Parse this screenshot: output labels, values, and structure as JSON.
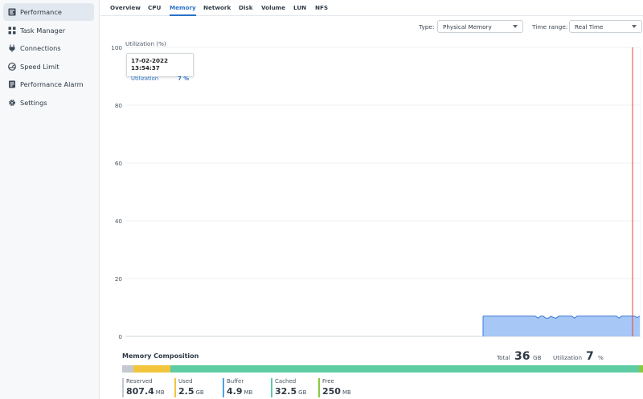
{
  "sidebar": {
    "items": [
      {
        "label": "Performance",
        "icon": "performance-icon",
        "active": true
      },
      {
        "label": "Task Manager",
        "icon": "task-manager-icon",
        "active": false
      },
      {
        "label": "Connections",
        "icon": "connections-icon",
        "active": false
      },
      {
        "label": "Speed Limit",
        "icon": "speed-limit-icon",
        "active": false
      },
      {
        "label": "Performance Alarm",
        "icon": "alarm-icon",
        "active": false
      },
      {
        "label": "Settings",
        "icon": "gear-icon",
        "active": false
      }
    ]
  },
  "tabs": [
    "Overview",
    "CPU",
    "Memory",
    "Network",
    "Disk",
    "Volume",
    "LUN",
    "NFS"
  ],
  "active_tab": "Memory",
  "controls": {
    "type_label": "Type:",
    "type_value": "Physical Memory",
    "time_label": "Time range:",
    "time_value": "Real Time"
  },
  "tooltip": {
    "date": "17-02-2022 13:54:37",
    "label": "Utilization",
    "value": "7 %"
  },
  "chart_data": {
    "type": "area",
    "ylabel": "Utilization (%)",
    "ylim": [
      0,
      100
    ],
    "yticks": [
      "100",
      "80",
      "60",
      "40",
      "20",
      "0"
    ],
    "grid": true,
    "series": [
      {
        "values": [
          7,
          7,
          7,
          7,
          7,
          7,
          7,
          7,
          7,
          7,
          7,
          7,
          7,
          7,
          7,
          7,
          7,
          7,
          7,
          7,
          7,
          6.3,
          7,
          7,
          6.3,
          6.3,
          7,
          6.5,
          6.3,
          7,
          7,
          7,
          7,
          7,
          7,
          6.3,
          7,
          7,
          7,
          7,
          7,
          7,
          7,
          7,
          7,
          7,
          7,
          7,
          7,
          7,
          7,
          7,
          6.3,
          7,
          7,
          7,
          7,
          7,
          7,
          6.5,
          7
        ]
      }
    ],
    "colors": {
      "fill": "#a2c4f5",
      "line": "#3a78d8",
      "cursor": "#e0453a"
    }
  },
  "composition": {
    "title": "Memory Composition",
    "total_label": "Total",
    "total_value": "36",
    "total_unit": "GB",
    "util_label": "Utilization",
    "util_value": "7",
    "util_unit": "%",
    "items": [
      {
        "name": "Reserved",
        "value": "807.4",
        "unit": "MB",
        "color": "#c3c9cf",
        "fraction": 0.022
      },
      {
        "name": "Used",
        "value": "2.5",
        "unit": "GB",
        "color": "#f2c53d",
        "fraction": 0.07
      },
      {
        "name": "Buffer",
        "value": "4.9",
        "unit": "MB",
        "color": "#4aa3e8",
        "fraction": 0.001
      },
      {
        "name": "Cached",
        "value": "32.5",
        "unit": "GB",
        "color": "#5ecca2",
        "fraction": 0.9
      },
      {
        "name": "Free",
        "value": "250",
        "unit": "MB",
        "color": "#88c940",
        "fraction": 0.007
      }
    ]
  }
}
